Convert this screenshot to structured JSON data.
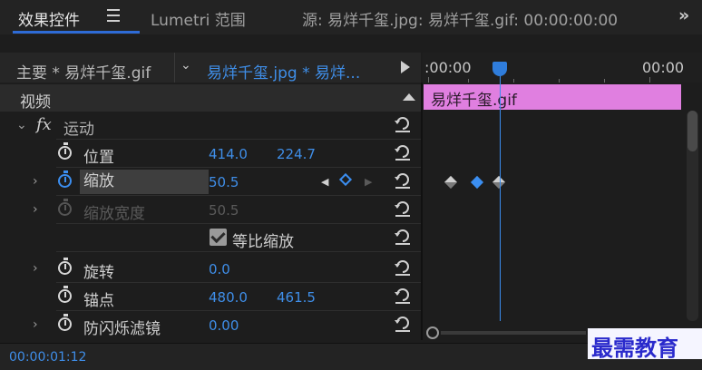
{
  "tabs": {
    "effect_controls": "效果控件",
    "lumetri": "Lumetri 范围",
    "source": "源: 易烊千玺.jpg: 易烊千玺.gif: 00:00:00:00"
  },
  "clip_header": {
    "master": "主要 * 易烊千玺.gif",
    "sequence": "易烊千玺.jpg * 易烊..."
  },
  "ruler": {
    "start": ":00:00",
    "end": "00:00"
  },
  "section": {
    "title": "视频"
  },
  "timeline_clip": {
    "label": "易烊千玺.gif",
    "color": "#e07fe0"
  },
  "effect": {
    "fx": "fx",
    "name": "运动"
  },
  "properties": {
    "position": {
      "label": "位置",
      "x": "414.0",
      "y": "224.7"
    },
    "scale": {
      "label": "缩放",
      "value": "50.5"
    },
    "scale_width": {
      "label": "缩放宽度",
      "value": "50.5"
    },
    "uniform_scale": {
      "label": "等比缩放",
      "checked": true
    },
    "rotation": {
      "label": "旋转",
      "value": "0.0"
    },
    "anchor": {
      "label": "锚点",
      "x": "480.0",
      "y": "461.5"
    },
    "anti_flicker": {
      "label": "防闪烁滤镜",
      "value": "0.00"
    }
  },
  "footer": {
    "timecode": "00:00:01:12"
  },
  "watermark": "最需教育",
  "colors": {
    "accent": "#3f8ee8",
    "playhead": "#3b8ef0"
  }
}
